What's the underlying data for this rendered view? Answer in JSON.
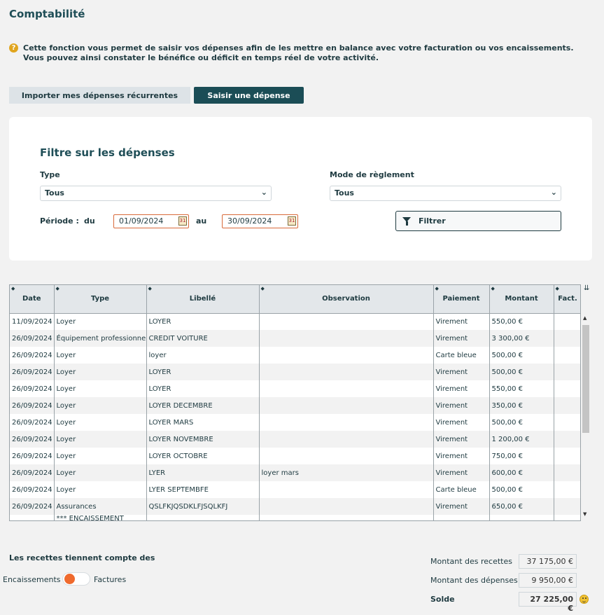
{
  "page": {
    "title": "Comptabilité",
    "info": "Cette fonction vous permet de saisir vos dépenses afin de les mettre en balance avec votre facturation ou vos encaissements. Vous pouvez ainsi constater le bénéfice ou déficit en temps réel de votre activité."
  },
  "actions": {
    "import_label": "Importer mes dépenses récurrentes",
    "saisir_label": "Saisir une dépense"
  },
  "filter": {
    "title": "Filtre sur les dépenses",
    "type_label": "Type",
    "type_value": "Tous",
    "mode_label": "Mode de règlement",
    "mode_value": "Tous",
    "periode_label": "Période :",
    "du_label": "du",
    "au_label": "au",
    "date_from": "01/09/2024",
    "date_to": "30/09/2024",
    "filter_button": "Filtrer"
  },
  "table": {
    "columns": [
      "Date",
      "Type",
      "Libellé",
      "Observation",
      "Paiement",
      "Montant",
      "Fact."
    ],
    "rows": [
      [
        "11/09/2024",
        "Loyer",
        "LOYER",
        "",
        "Virement",
        "550,00 €",
        ""
      ],
      [
        "26/09/2024",
        "Équipement professionnel",
        "CREDIT VOITURE",
        "",
        "Virement",
        "3 300,00 €",
        ""
      ],
      [
        "26/09/2024",
        "Loyer",
        "loyer",
        "",
        "Carte bleue",
        "500,00 €",
        ""
      ],
      [
        "26/09/2024",
        "Loyer",
        "LOYER",
        "",
        "Virement",
        "500,00 €",
        ""
      ],
      [
        "26/09/2024",
        "Loyer",
        "LOYER",
        "",
        "Virement",
        "550,00 €",
        ""
      ],
      [
        "26/09/2024",
        "Loyer",
        "LOYER DECEMBRE",
        "",
        "Virement",
        "350,00 €",
        ""
      ],
      [
        "26/09/2024",
        "Loyer",
        "LOYER MARS",
        "",
        "Virement",
        "500,00 €",
        ""
      ],
      [
        "26/09/2024",
        "Loyer",
        "LOYER NOVEMBRE",
        "",
        "Virement",
        "1 200,00 €",
        ""
      ],
      [
        "26/09/2024",
        "Loyer",
        "LOYER OCTOBRE",
        "",
        "Virement",
        "750,00 €",
        ""
      ],
      [
        "26/09/2024",
        "Loyer",
        "LYER",
        "loyer mars",
        "Virement",
        "600,00 €",
        ""
      ],
      [
        "26/09/2024",
        "Loyer",
        "LYER SEPTEMBFE",
        "",
        "Carte bleue",
        "500,00 €",
        ""
      ],
      [
        "26/09/2024",
        "Assurances",
        "QSLFKJQSDKLFJSQLKFJ",
        "",
        "Virement",
        "650,00 €",
        ""
      ],
      [
        "",
        "*** ENCAISSEMENT",
        "",
        "",
        "",
        "",
        ""
      ]
    ]
  },
  "recettes": {
    "title": "Les recettes tiennent compte des",
    "left_option": "Encaissements",
    "right_option": "Factures"
  },
  "summary": {
    "recettes_label": "Montant des recettes",
    "recettes_value": "37 175,00 €",
    "depenses_label": "Montant des dépenses",
    "depenses_value": "9 950,00 €",
    "solde_label": "Solde",
    "solde_value": "27 225,00 €"
  }
}
